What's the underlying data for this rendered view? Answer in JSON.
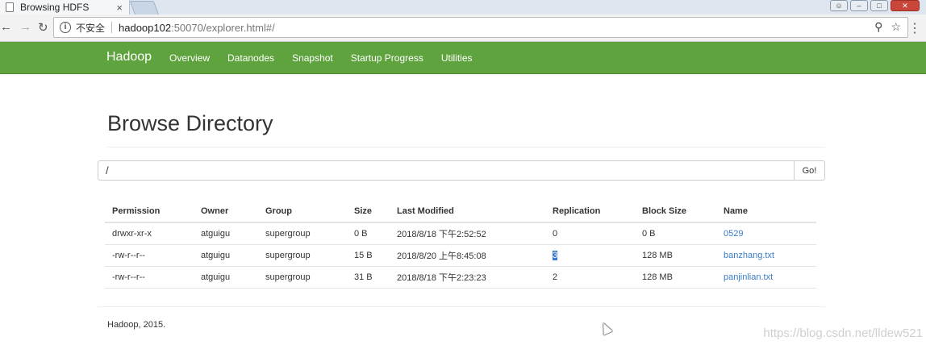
{
  "browser": {
    "tab_title": "Browsing HDFS",
    "tab_close": "×",
    "insecure_label": "不安全",
    "url_host": "hadoop102",
    "url_rest": ":50070/explorer.html#/"
  },
  "navbar": {
    "brand": "Hadoop",
    "items": [
      "Overview",
      "Datanodes",
      "Snapshot",
      "Startup Progress",
      "Utilities"
    ]
  },
  "page": {
    "title": "Browse Directory",
    "path_value": "/",
    "go_label": "Go!"
  },
  "table": {
    "headers": [
      "Permission",
      "Owner",
      "Group",
      "Size",
      "Last Modified",
      "Replication",
      "Block Size",
      "Name"
    ],
    "rows": [
      [
        "drwxr-xr-x",
        "atguigu",
        "supergroup",
        "0 B",
        "2018/8/18 下午2:52:52",
        "0",
        "0 B",
        "0529"
      ],
      [
        "-rw-r--r--",
        "atguigu",
        "supergroup",
        "15 B",
        "2018/8/20 上午8:45:08",
        "3",
        "128 MB",
        "banzhang.txt"
      ],
      [
        "-rw-r--r--",
        "atguigu",
        "supergroup",
        "31 B",
        "2018/8/18 下午2:23:23",
        "2",
        "128 MB",
        "panjinlian.txt"
      ]
    ]
  },
  "footer": "Hadoop, 2015.",
  "watermark": "https://blog.csdn.net/lldew521",
  "colors": {
    "navbar": "#5fa33e",
    "link": "#3b7dc8",
    "selection": "#3b79d4"
  }
}
